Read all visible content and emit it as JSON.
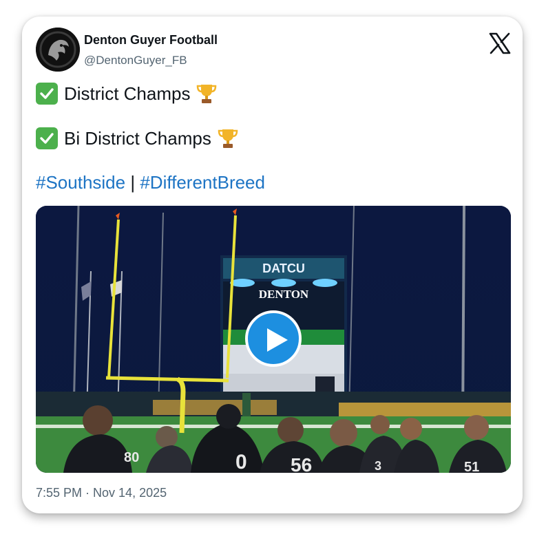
{
  "author": {
    "name": "Denton Guyer Football",
    "handle": "@DentonGuyer_FB",
    "avatar_icon": "panther-logo-icon"
  },
  "platform_icon": "x-logo-icon",
  "tweet": {
    "lines": [
      {
        "text": "District Champs",
        "prefix_icon": "check-mark-button-icon",
        "suffix_icon": "trophy-icon"
      },
      {
        "text": "Bi District Champs",
        "prefix_icon": "check-mark-button-icon",
        "suffix_icon": "trophy-icon"
      }
    ],
    "hashtags": [
      "#Southside",
      "#DifferentBreed"
    ],
    "hashtag_separator": "|"
  },
  "media": {
    "type": "video",
    "scoreboard_sponsor": "DATCU",
    "scoreboard_team": "DENTON",
    "jersey_numbers": [
      "80",
      "0",
      "56",
      "3",
      "51"
    ],
    "play_icon": "play-icon"
  },
  "timestamp": "7:55 PM · Nov 14, 2025",
  "colors": {
    "link": "#1d74c4",
    "play_button": "#1d8fe0",
    "check": "#4cb04c",
    "night_sky": "#0a1330"
  }
}
